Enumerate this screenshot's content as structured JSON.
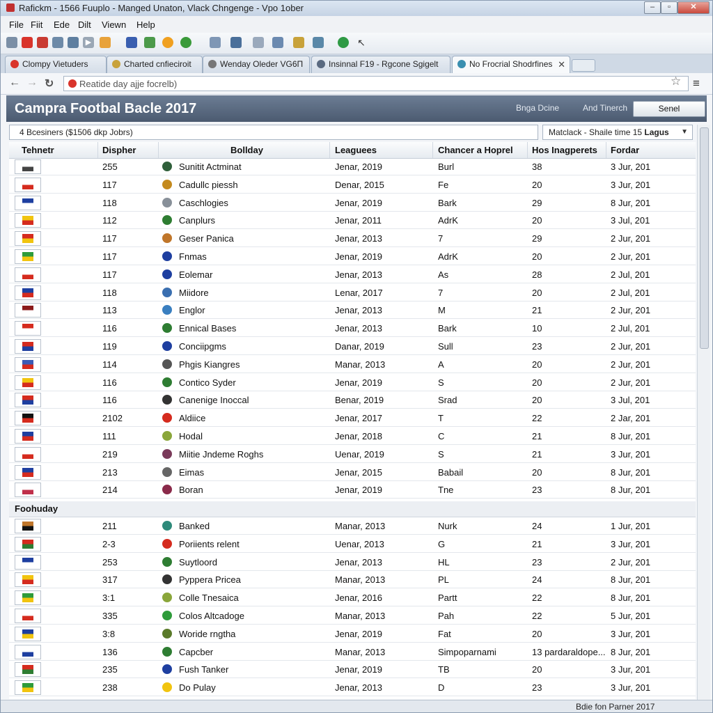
{
  "window": {
    "title": "Rafickm - 1566 Fuuplo - Manged Unaton, Vlack Chngenge - Vpo 1ober"
  },
  "menu": [
    "File",
    "Fiit",
    "Ede",
    "Dilt",
    "Viewn",
    "Help"
  ],
  "tabs": [
    {
      "label": "Clompy Vietuders",
      "color": "#d9342b"
    },
    {
      "label": "Charted cnfieciroit",
      "color": "#c8a23a"
    },
    {
      "label": "Wenday Oleder VG6Π",
      "color": "#777777"
    },
    {
      "label": "Insinnal F19 - Rgcone Sgigelt",
      "color": "#5a6a80"
    },
    {
      "label": "No Frocrial Shodrfines",
      "color": "#3a8fb0"
    }
  ],
  "address": {
    "placeholder": "Reatide day ajje focrelb)"
  },
  "header": {
    "title": "Campra Footbal Bacle 2017",
    "link1": "Bnga Dcine",
    "link2": "And Tinerch",
    "button": "Senel"
  },
  "filter": {
    "left": "4 Bcesiners ($1506 dkp Jobrs)",
    "select_prefix": "Matclack - Shaile time 15 ",
    "select_bold": "Lagus"
  },
  "columns": [
    "Tehnetr",
    "Dispher",
    "Bollday",
    "Leaguees",
    "Chancer a Hoprel",
    "Hos Inagperets",
    "Fordar"
  ],
  "section2_title": "Foohuday",
  "rows": [
    {
      "n": "255",
      "club": "Sunitit Actminat",
      "date": "Jenar, 2019",
      "code": "Burl",
      "pts": "38",
      "end": "3 Jur, 201",
      "c1": "#ffffff",
      "c2": "#444444",
      "ic": "#2f5f3a"
    },
    {
      "n": "117",
      "club": "Cadullc piessh",
      "date": "Denar, 2015",
      "code": "Fe",
      "pts": "20",
      "end": "3 Jur, 201",
      "c1": "#ffffff",
      "c2": "#d52b1e",
      "ic": "#c48a1e"
    },
    {
      "n": "118",
      "club": "Caschlogies",
      "date": "Jenar, 2019",
      "code": "Bark",
      "pts": "29",
      "end": "8 Jur, 201",
      "c1": "#1e3fa0",
      "c2": "#ffffff",
      "ic": "#889099"
    },
    {
      "n": "112",
      "club": "Canplurs",
      "date": "Jenar, 2011",
      "code": "AdrK",
      "pts": "20",
      "end": "3 Jul, 201",
      "c1": "#f1c40f",
      "c2": "#d52b1e",
      "ic": "#2e7d32"
    },
    {
      "n": "117",
      "club": "Geser Panica",
      "date": "Jenar, 2013",
      "code": "7",
      "pts": "29",
      "end": "2 Jur, 201",
      "c1": "#d52b1e",
      "c2": "#f1c40f",
      "ic": "#c0762a"
    },
    {
      "n": "117",
      "club": "Fnmas",
      "date": "Jenar, 2019",
      "code": "AdrK",
      "pts": "20",
      "end": "2 Jur, 201",
      "c1": "#2e9b3a",
      "c2": "#f1c40f",
      "ic": "#1e3fa0"
    },
    {
      "n": "117",
      "club": "Eolemar",
      "date": "Jenar, 2013",
      "code": "As",
      "pts": "28",
      "end": "2 Jul, 201",
      "c1": "#ffffff",
      "c2": "#d52b1e",
      "ic": "#1e3fa0"
    },
    {
      "n": "118",
      "club": "Miidore",
      "date": "Lenar, 2017",
      "code": "7",
      "pts": "20",
      "end": "2 Jul, 201",
      "c1": "#1e3fa0",
      "c2": "#d52b1e",
      "ic": "#3a6fb0"
    },
    {
      "n": "113",
      "club": "Englor",
      "date": "Jenar, 2013",
      "code": "M",
      "pts": "21",
      "end": "2 Jur, 201",
      "c1": "#8b1a1a",
      "c2": "#ffffff",
      "ic": "#3a7fc0"
    },
    {
      "n": "116",
      "club": "Ennical Bases",
      "date": "Jenar, 2013",
      "code": "Bark",
      "pts": "10",
      "end": "2 Jul, 201",
      "c1": "#d52b1e",
      "c2": "#ffffff",
      "ic": "#2e7d32"
    },
    {
      "n": "119",
      "club": "Conciipgms",
      "date": "Danar, 2019",
      "code": "Sull",
      "pts": "23",
      "end": "2 Jur, 201",
      "c1": "#d52b1e",
      "c2": "#1e3fa0",
      "ic": "#1e3fa0"
    },
    {
      "n": "114",
      "club": "Phgis Kiangres",
      "date": "Manar, 2013",
      "code": "A",
      "pts": "20",
      "end": "2 Jur, 201",
      "c1": "#3c5bb5",
      "c2": "#d52b1e",
      "ic": "#555555"
    },
    {
      "n": "116",
      "club": "Contico Syder",
      "date": "Jenar, 2019",
      "code": "S",
      "pts": "20",
      "end": "2 Jur, 201",
      "c1": "#f1c40f",
      "c2": "#d52b1e",
      "ic": "#2e7d32"
    },
    {
      "n": "116",
      "club": "Canenige Inoccal",
      "date": "Benar, 2019",
      "code": "Srad",
      "pts": "20",
      "end": "3 Jul, 201",
      "c1": "#d52b1e",
      "c2": "#1e3fa0",
      "ic": "#333333"
    },
    {
      "n": "2102",
      "club": "Aldiice",
      "date": "Jenar, 2017",
      "code": "T",
      "pts": "22",
      "end": "2 Jar, 201",
      "c1": "#111111",
      "c2": "#d52b1e",
      "ic": "#d52b1e"
    },
    {
      "n": "111",
      "club": "Hodal",
      "date": "Jenar, 2018",
      "code": "C",
      "pts": "21",
      "end": "8 Jur, 201",
      "c1": "#1e3fa0",
      "c2": "#d52b1e",
      "ic": "#8aa63a"
    },
    {
      "n": "219",
      "club": "Miitie Jndeme Roghs",
      "date": "Uenar, 2019",
      "code": "S",
      "pts": "21",
      "end": "3 Jur, 201",
      "c1": "#ffffff",
      "c2": "#d52b1e",
      "ic": "#7a3a5a"
    },
    {
      "n": "213",
      "club": "Eimas",
      "date": "Jenar, 2015",
      "code": "Babail",
      "pts": "20",
      "end": "8 Jur, 201",
      "c1": "#1e3fa0",
      "c2": "#d52b1e",
      "ic": "#666666"
    },
    {
      "n": "214",
      "club": "Boran",
      "date": "Jenar, 2019",
      "code": "Tne",
      "pts": "23",
      "end": "8 Jur, 201",
      "c1": "#ffffff",
      "c2": "#c0304a",
      "ic": "#8a2a4a"
    }
  ],
  "rows2": [
    {
      "n": "211",
      "club": "Banked",
      "date": "Manar, 2013",
      "code": "Nurk",
      "pts": "24",
      "end": "1 Jur, 201",
      "c1": "#c0762a",
      "c2": "#111111",
      "ic": "#2e8a7a"
    },
    {
      "n": "2-3",
      "club": "Poriients relent",
      "date": "Uenar, 2013",
      "code": "G",
      "pts": "21",
      "end": "3 Jur, 201",
      "c1": "#d52b1e",
      "c2": "#2e7d32",
      "ic": "#d52b1e"
    },
    {
      "n": "253",
      "club": "Suytloord",
      "date": "Jenar, 2013",
      "code": "HL",
      "pts": "23",
      "end": "2 Jur, 201",
      "c1": "#1e3fa0",
      "c2": "#ffffff",
      "ic": "#2e7d32"
    },
    {
      "n": "317",
      "club": "Pyppera Pricea",
      "date": "Manar, 2013",
      "code": "PL",
      "pts": "24",
      "end": "8 Jur, 201",
      "c1": "#f1c40f",
      "c2": "#d52b1e",
      "ic": "#333333"
    },
    {
      "n": "3:1",
      "club": "Colle Tnesaica",
      "date": "Jenar, 2016",
      "code": "Partt",
      "pts": "22",
      "end": "8 Jur, 201",
      "c1": "#2e9b3a",
      "c2": "#f1c40f",
      "ic": "#8aa63a"
    },
    {
      "n": "335",
      "club": "Colos Altcadoge",
      "date": "Manar, 2013",
      "code": "Pah",
      "pts": "22",
      "end": "5 Jur, 201",
      "c1": "#ffffff",
      "c2": "#d52b1e",
      "ic": "#2e9b3a"
    },
    {
      "n": "3:8",
      "club": "Woride rngtha",
      "date": "Jenar, 2019",
      "code": "Fat",
      "pts": "20",
      "end": "3 Jur, 201",
      "c1": "#1e3fa0",
      "c2": "#f1c40f",
      "ic": "#5a7a2a"
    },
    {
      "n": "136",
      "club": "Capcber",
      "date": "Manar, 2013",
      "code": "Simpoparnami",
      "pts": "13 pardaraldope...",
      "end": "8 Jur, 201",
      "c1": "#ffffff",
      "c2": "#1e3fa0",
      "ic": "#2e7d32"
    },
    {
      "n": "235",
      "club": "Fush Tanker",
      "date": "Jenar, 2019",
      "code": "TB",
      "pts": "20",
      "end": "3 Jur, 201",
      "c1": "#d52b1e",
      "c2": "#2e7d32",
      "ic": "#1e3fa0"
    },
    {
      "n": "238",
      "club": "Do Pulay",
      "date": "Jenar, 2013",
      "code": "D",
      "pts": "23",
      "end": "3 Jur, 201",
      "c1": "#2e9b3a",
      "c2": "#f1c40f",
      "ic": "#f1c40f"
    }
  ],
  "status": "Bdie fon Parner 2017"
}
